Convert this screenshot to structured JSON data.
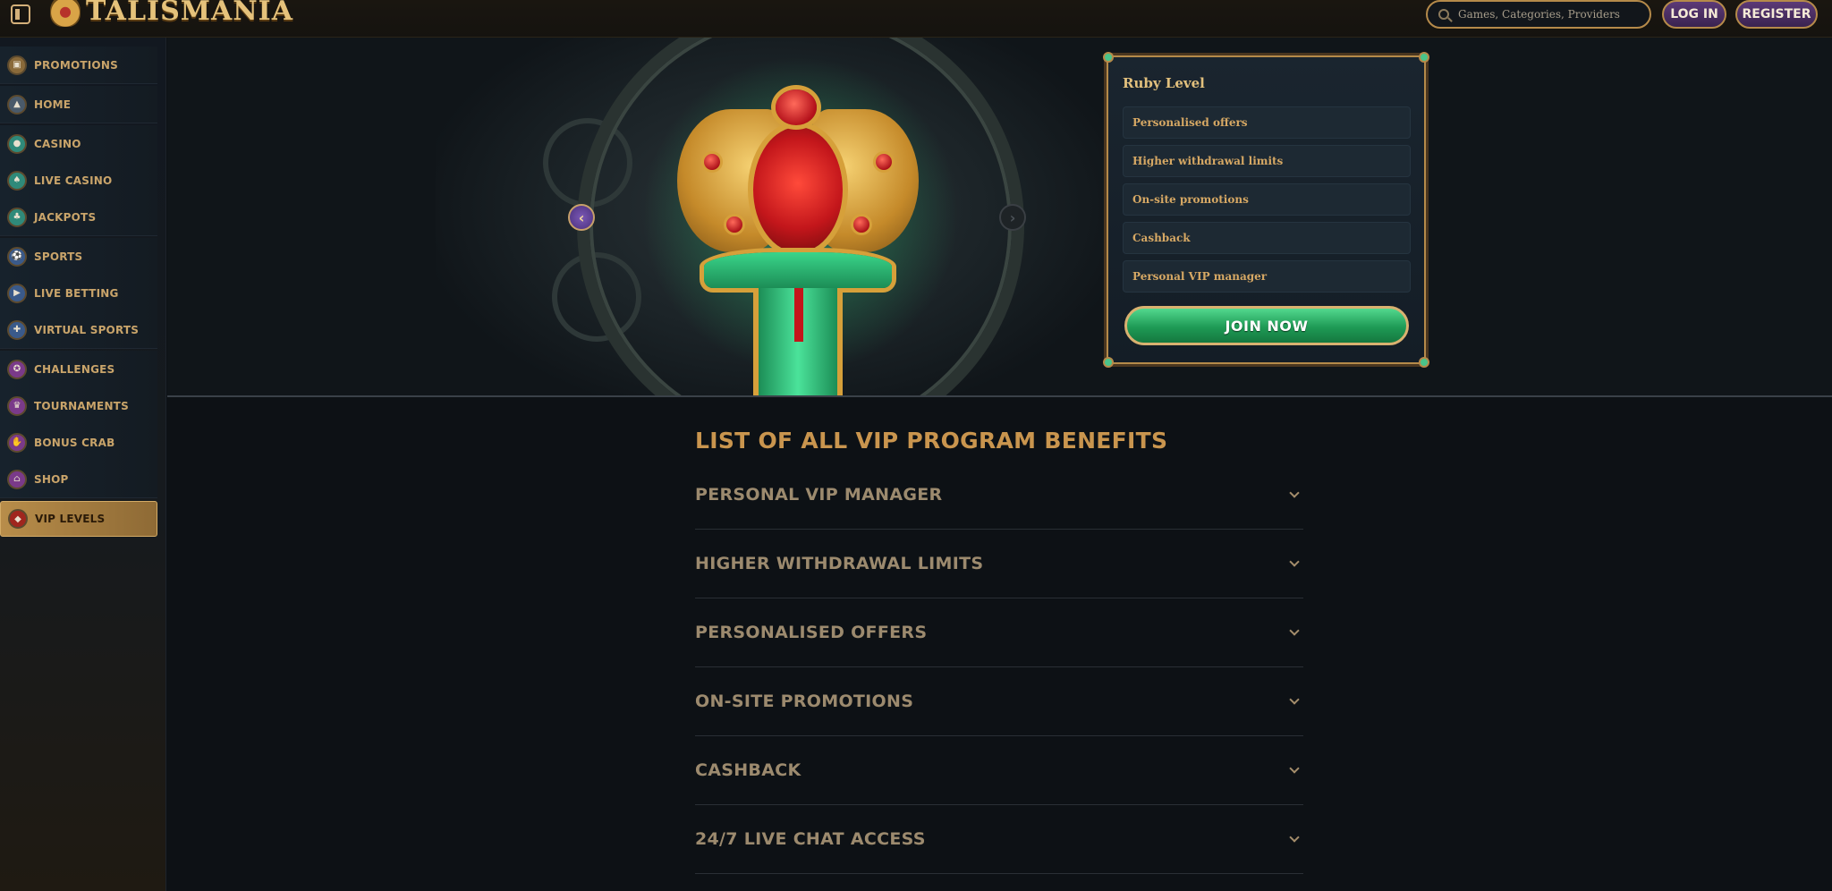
{
  "header": {
    "brand": "TALISMANIA",
    "search_placeholder": "Games, Categories, Providers",
    "login_label": "LOG IN",
    "register_label": "REGISTER"
  },
  "sidebar": {
    "items": [
      {
        "label": "PROMOTIONS",
        "icon": "gift-icon",
        "color": "#8a6a3a"
      },
      {
        "label": "HOME",
        "icon": "pyramid-icon",
        "color": "#4a5a6a"
      },
      {
        "label": "CASINO",
        "icon": "chip-icon",
        "color": "#2f8a7a"
      },
      {
        "label": "LIVE CASINO",
        "icon": "spade-icon",
        "color": "#2f8a7a"
      },
      {
        "label": "JACKPOTS",
        "icon": "clover-icon",
        "color": "#2f8a7a"
      },
      {
        "label": "SPORTS",
        "icon": "ball-icon",
        "color": "#3a5a8a"
      },
      {
        "label": "LIVE BETTING",
        "icon": "tv-icon",
        "color": "#3a5a8a"
      },
      {
        "label": "VIRTUAL SPORTS",
        "icon": "gamepad-icon",
        "color": "#3a5a8a"
      },
      {
        "label": "CHALLENGES",
        "icon": "medal-icon",
        "color": "#7a3a8a"
      },
      {
        "label": "TOURNAMENTS",
        "icon": "trophy-icon",
        "color": "#7a3a8a"
      },
      {
        "label": "BONUS CRAB",
        "icon": "claw-icon",
        "color": "#7a3a8a"
      },
      {
        "label": "SHOP",
        "icon": "shop-icon",
        "color": "#7a3a8a"
      },
      {
        "label": "VIP LEVELS",
        "icon": "diamond-icon",
        "color": "#a0261e",
        "active": true
      }
    ]
  },
  "vip_card": {
    "title": "Ruby Level",
    "benefits": [
      "Personalised offers",
      "Higher withdrawal limits",
      "On-site promotions",
      "Cashback",
      "Personal VIP manager"
    ],
    "join_label": "JOIN NOW"
  },
  "benefits_list": {
    "title": "LIST OF ALL VIP PROGRAM BENEFITS",
    "items": [
      "PERSONAL VIP MANAGER",
      "HIGHER WITHDRAWAL LIMITS",
      "PERSONALISED OFFERS",
      "ON-SITE PROMOTIONS",
      "CASHBACK",
      "24/7 LIVE CHAT ACCESS"
    ]
  }
}
